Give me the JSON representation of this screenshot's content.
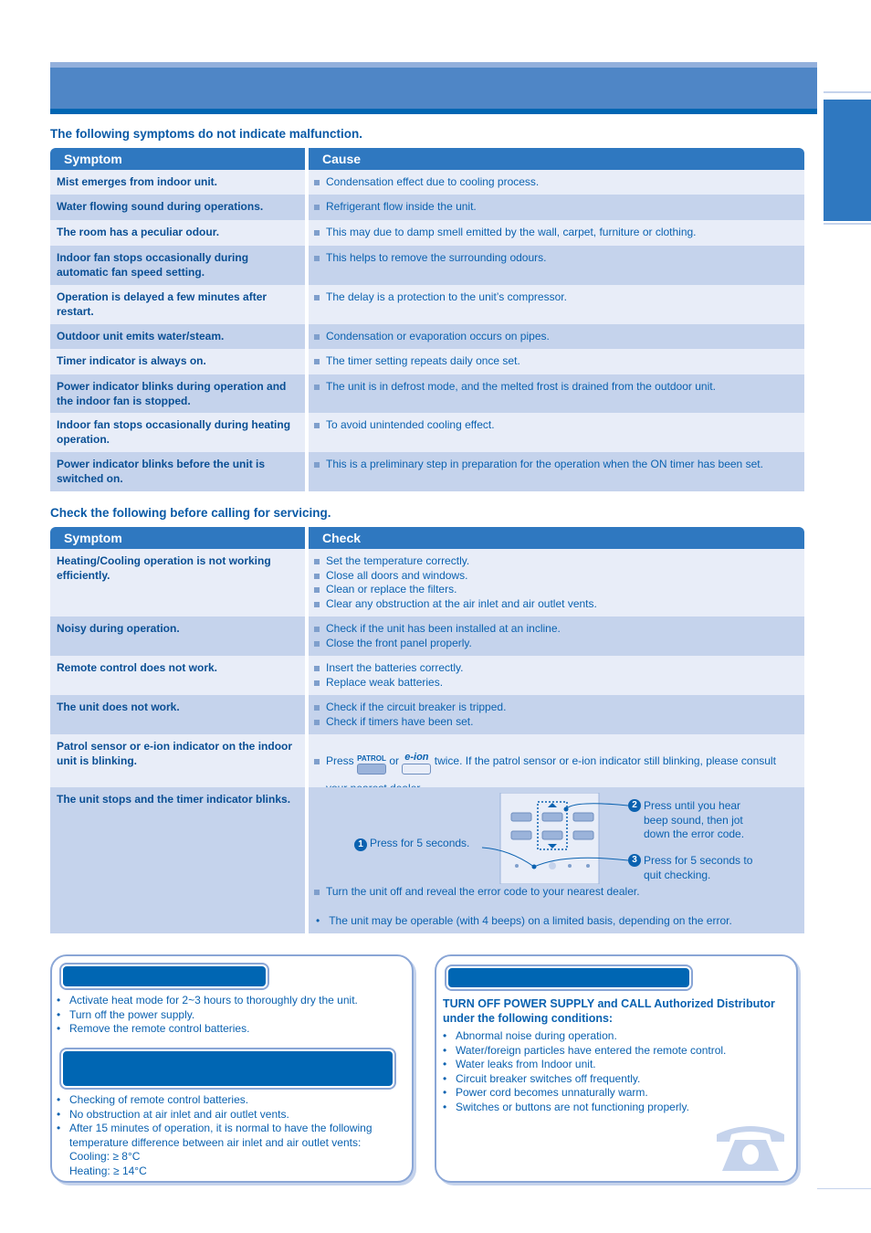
{
  "section1": {
    "title": "The following symptoms do not indicate malfunction.",
    "headers": [
      "Symptom",
      "Cause"
    ],
    "rows": [
      {
        "symptom": "Mist emerges from indoor unit.",
        "cause": "Condensation effect due to cooling process."
      },
      {
        "symptom": "Water flowing sound during operations.",
        "cause": "Refrigerant flow inside the unit."
      },
      {
        "symptom": "The room has a peculiar odour.",
        "cause": "This may due to damp smell emitted by the wall, carpet, furniture or clothing."
      },
      {
        "symptom": "Indoor fan stops occasionally during automatic fan speed setting.",
        "cause": "This helps to remove the surrounding odours."
      },
      {
        "symptom": "Operation is delayed a few minutes after restart.",
        "cause": "The delay is a protection to the unit’s compressor."
      },
      {
        "symptom": "Outdoor unit emits water/steam.",
        "cause": "Condensation or evaporation occurs on pipes."
      },
      {
        "symptom": "Timer indicator is always on.",
        "cause": "The timer setting repeats daily once set."
      },
      {
        "symptom": "Power indicator blinks during operation and the indoor fan is stopped.",
        "cause": "The unit is in defrost mode, and the melted frost is drained from the outdoor unit."
      },
      {
        "symptom": "Indoor fan stops occasionally during heating operation.",
        "cause": "To avoid unintended cooling effect."
      },
      {
        "symptom": "Power indicator blinks before the unit is switched on.",
        "cause": "This is a preliminary step in preparation for the operation when the ON timer has been set."
      }
    ]
  },
  "section2": {
    "title": "Check the following before calling for servicing.",
    "headers": [
      "Symptom",
      "Check"
    ],
    "rows": [
      {
        "symptom": "Heating/Cooling operation is not working efficiently.",
        "checks": [
          "Set the temperature correctly.",
          "Close all doors and windows.",
          "Clean or replace the filters.",
          "Clear any obstruction at the air inlet and air outlet vents."
        ]
      },
      {
        "symptom": "Noisy during operation.",
        "checks": [
          "Check if the unit has been installed at an incline.",
          "Close the front panel properly."
        ]
      },
      {
        "symptom": "Remote control does not work.",
        "checks": [
          "Insert the batteries correctly.",
          "Replace weak batteries."
        ]
      },
      {
        "symptom": "The unit does not work.",
        "checks": [
          "Check if the circuit breaker is tripped.",
          "Check if timers have been set."
        ]
      },
      {
        "symptom": "Patrol sensor or e-ion indicator on the indoor unit is blinking.",
        "press": "Press",
        "patrol": "PATROL",
        "or": "or",
        "eion": "e-ion",
        "rest": "twice. If the patrol sensor or e-ion indicator still blinking, please consult your nearest dealer."
      },
      {
        "symptom": "The unit stops and the timer indicator blinks.",
        "step1": "Press for 5 seconds.",
        "step2": "Press until you hear beep sound, then jot down the error code.",
        "step3": "Press for 5 seconds to quit checking.",
        "n1": "1",
        "n2": "2",
        "n3": "3",
        "check": "Turn the unit off and reveal the error code to your nearest dealer.",
        "note": "The unit may be operable (with 4 beeps) on a limited basis, depending on the error."
      }
    ]
  },
  "box1": {
    "items": [
      "Activate heat mode for 2~3 hours to thoroughly dry the unit.",
      "Turn off the power supply.",
      "Remove the remote control batteries."
    ],
    "items2": [
      "Checking of remote control batteries.",
      "No obstruction at air inlet and air outlet vents.",
      "After 15 minutes of operation, it is normal to have the following temperature difference between air inlet and air outlet vents:"
    ],
    "cooling": "Cooling: ≥ 8°C",
    "heating": "Heating: ≥ 14°C"
  },
  "box2": {
    "heading": "TURN OFF POWER SUPPLY and CALL Authorized Distributor under the following conditions:",
    "items": [
      "Abnormal noise during operation.",
      "Water/foreign particles have entered the remote control.",
      "Water leaks from Indoor unit.",
      "Circuit breaker switches off frequently.",
      "Power cord becomes unnaturally warm.",
      "Switches or buttons are not functioning properly."
    ],
    "icon": "telephone-icon"
  }
}
